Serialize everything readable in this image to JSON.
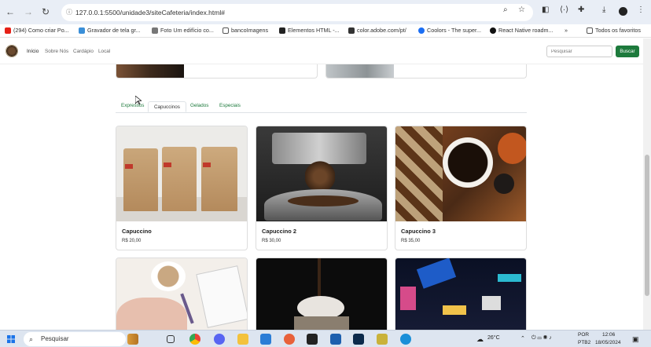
{
  "browser": {
    "url": "127.0.0.1:5500/unidade3/siteCafeteria/index.html#",
    "bookmarks": [
      {
        "label": "(294) Como criar Po...",
        "color": "#e62117"
      },
      {
        "label": "Gravador de tela gr...",
        "color": "#3a8fd8"
      },
      {
        "label": "Foto Um edifício co...",
        "color": "#777777"
      },
      {
        "label": "bancoImagens",
        "color": "#555555"
      },
      {
        "label": "Elementos HTML -...",
        "color": "#222222"
      },
      {
        "label": "color.adobe.com/pt/",
        "color": "#333333"
      },
      {
        "label": "Coolors - The super...",
        "color": "#1b6ef3"
      },
      {
        "label": "React Native roadm...",
        "color": "#111111"
      }
    ],
    "more_bookmarks": "»",
    "all_favorites": "Todos os favoritos"
  },
  "site": {
    "nav": [
      "Início",
      "Sobre Nós",
      "Cardápio",
      "Local"
    ],
    "search_placeholder": "Pesquisar",
    "search_button": "Buscar",
    "tabs": [
      "Expressos",
      "Capuccinos",
      "Gelados",
      "Especiais"
    ],
    "active_tab": "Capuccinos",
    "cards": [
      {
        "title": "Capuccino",
        "price": "R$ 20,00"
      },
      {
        "title": "Capuccino 2",
        "price": "R$ 30,00"
      },
      {
        "title": "Capuccino 3",
        "price": "R$ 35,00"
      }
    ]
  },
  "taskbar": {
    "search_label": "Pesquisar",
    "temperature": "26°C",
    "lang": "POR",
    "layout": "PTB2",
    "time": "12:06",
    "date": "18/05/2024"
  }
}
